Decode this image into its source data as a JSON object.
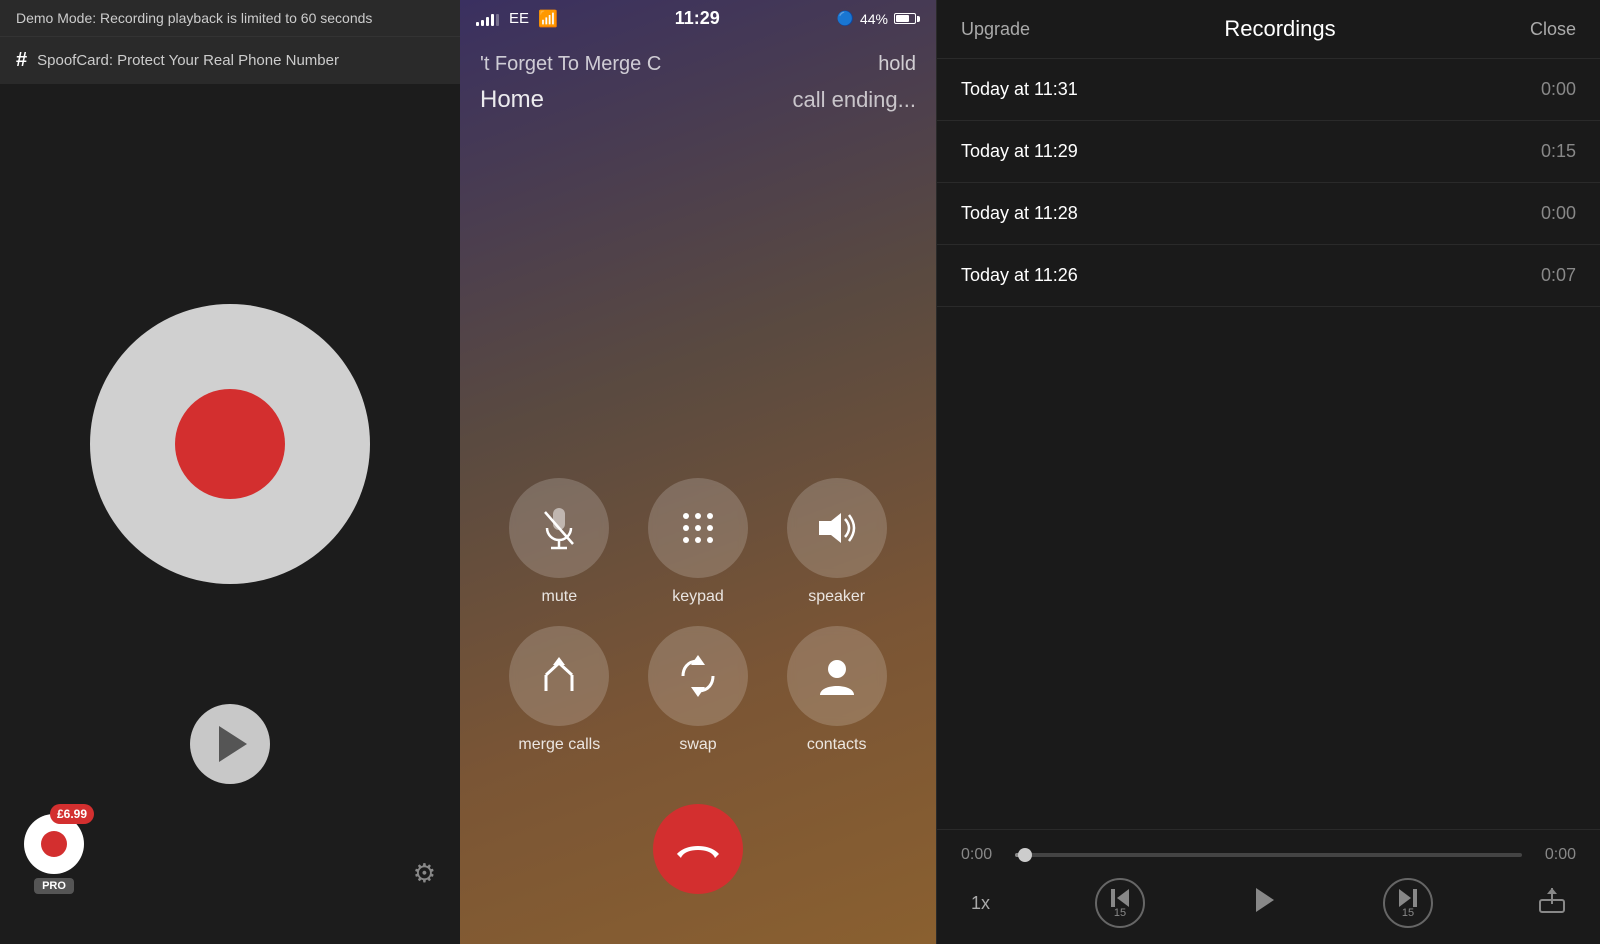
{
  "left": {
    "demo_banner": "Demo Mode: Recording playback is limited to 60 seconds",
    "spoof_card_text": "SpoofCard: Protect Your Real Phone Number",
    "hash_symbol": "#",
    "pro_price": "£6.99",
    "pro_label": "PRO",
    "settings_symbol": "⚙"
  },
  "middle": {
    "status_bar": {
      "carrier": "EE",
      "time": "11:29",
      "battery_pct": "44%"
    },
    "call_top_left": "'t Forget To Merge C",
    "call_top_right": "hold",
    "call_bottom_left": "Home",
    "call_bottom_right": "call ending...",
    "buttons": [
      {
        "id": "mute",
        "label": "mute"
      },
      {
        "id": "keypad",
        "label": "keypad"
      },
      {
        "id": "speaker",
        "label": "speaker"
      },
      {
        "id": "merge",
        "label": "merge calls"
      },
      {
        "id": "swap",
        "label": "swap"
      },
      {
        "id": "contacts",
        "label": "contacts"
      }
    ]
  },
  "right": {
    "header": {
      "upgrade_label": "Upgrade",
      "title": "Recordings",
      "close_label": "Close"
    },
    "recordings": [
      {
        "date": "Today at 11:31",
        "duration": "0:00"
      },
      {
        "date": "Today at 11:29",
        "duration": "0:15"
      },
      {
        "date": "Today at 11:28",
        "duration": "0:00"
      },
      {
        "date": "Today at 11:26",
        "duration": "0:07"
      }
    ],
    "player": {
      "current_time": "0:00",
      "end_time": "0:00",
      "speed": "1x",
      "skip_back": "15",
      "skip_forward": "15"
    }
  }
}
